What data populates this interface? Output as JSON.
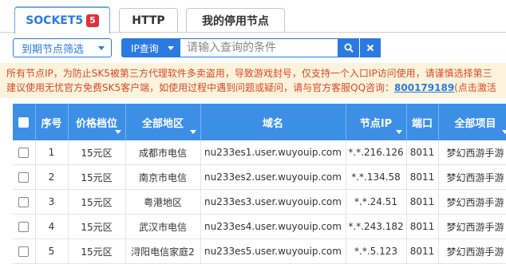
{
  "tabs": [
    {
      "label": "SOCKET5",
      "badge": "5",
      "active": true
    },
    {
      "label": "HTTP"
    },
    {
      "label": "我的停用节点"
    }
  ],
  "filter": {
    "expiry_label": "到期节点筛选",
    "ip_query_label": "IP查询",
    "search_placeholder": "请输入查询的条件",
    "search_icon": "search-icon",
    "clear_icon": "close-icon"
  },
  "notice": {
    "line1": "所有节点IP，为防止SK5被第三方代理软件多卖盗用，导致游戏封号，仅支持一个入口IP访问使用，请谨慎选择第三",
    "line2_prefix": "建议使用无忧官方免费SK5客户端，如使用过程中遇到问题或疑问，请与官方客服QQ咨询：",
    "qq": "800179189",
    "line2_suffix": "(点击激活"
  },
  "table": {
    "headers": [
      "序号",
      "价格档位",
      "全部地区",
      "域名",
      "节点IP",
      "端口",
      "全部项目"
    ],
    "rows": [
      {
        "no": "1",
        "price": "15元区",
        "region": "成都市电信",
        "domain": "nu233es1.user.wuyouip.com",
        "ip": "*.*.216.126",
        "port": "8011",
        "project": "梦幻西游手游"
      },
      {
        "no": "2",
        "price": "15元区",
        "region": "南京市电信",
        "domain": "nu233es2.user.wuyouip.com",
        "ip": "*.*.134.58",
        "port": "8011",
        "project": "梦幻西游手游"
      },
      {
        "no": "3",
        "price": "15元区",
        "region": "粤港地区",
        "domain": "nu233es3.user.wuyouip.com",
        "ip": "*.*.24.51",
        "port": "8011",
        "project": "梦幻西游手游"
      },
      {
        "no": "4",
        "price": "15元区",
        "region": "武汉市电信",
        "domain": "nu233es4.user.wuyouip.com",
        "ip": "*.*.243.182",
        "port": "8011",
        "project": "梦幻西游手游"
      },
      {
        "no": "5",
        "price": "15元区",
        "region": "浔阳电信家庭2",
        "domain": "nu233es5.user.wuyouip.com",
        "ip": "*.*.5.123",
        "port": "8011",
        "project": "梦幻西游手游"
      }
    ]
  },
  "colors": {
    "accent": "#2a7ae2",
    "header_bg": "#3d8fe6",
    "badge": "#e0313b",
    "notice_bg": "#fcf3dc",
    "notice_text": "#d9492a"
  }
}
